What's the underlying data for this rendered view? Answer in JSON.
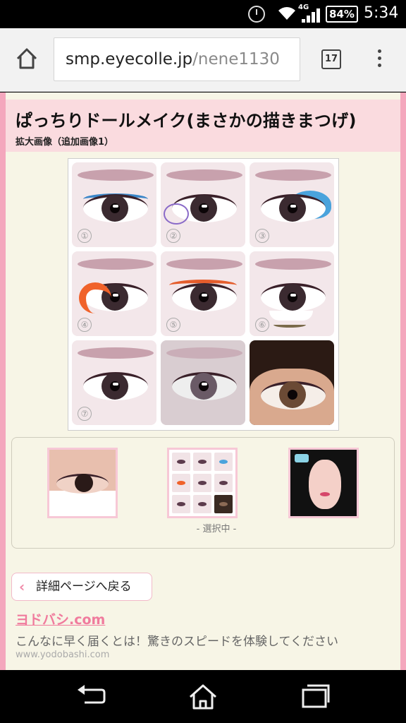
{
  "status_bar": {
    "network": "4G",
    "battery": "84%",
    "time": "5:34",
    "icons": [
      "alarm-clock-icon",
      "wifi-icon",
      "signal-icon",
      "battery-icon"
    ]
  },
  "browser": {
    "url_host": "smp.eyecolle.jp",
    "url_path": "/nene1130",
    "tab_count": "17"
  },
  "page": {
    "title": "ぱっちりドールメイク(まさかの描きまつげ)",
    "subtitle": "拡大画像（追加画像1）",
    "steps": [
      "①",
      "②",
      "③",
      "④",
      "⑤",
      "⑥",
      "⑦"
    ],
    "thumbnail_selected_label": "- 選択中 -",
    "back_button": "詳細ページへ戻る",
    "ad": {
      "brand": "ヨドバシ.com",
      "copy": "こんなに早く届くとは！驚きのスピードを体験してください",
      "domain": "www.yodobashi.com"
    }
  },
  "colors": {
    "accent_pink": "#f4a7bd",
    "header_bg": "#fadbdf",
    "page_bg": "#f7f5e6",
    "brand_pink": "#f07b9d"
  }
}
